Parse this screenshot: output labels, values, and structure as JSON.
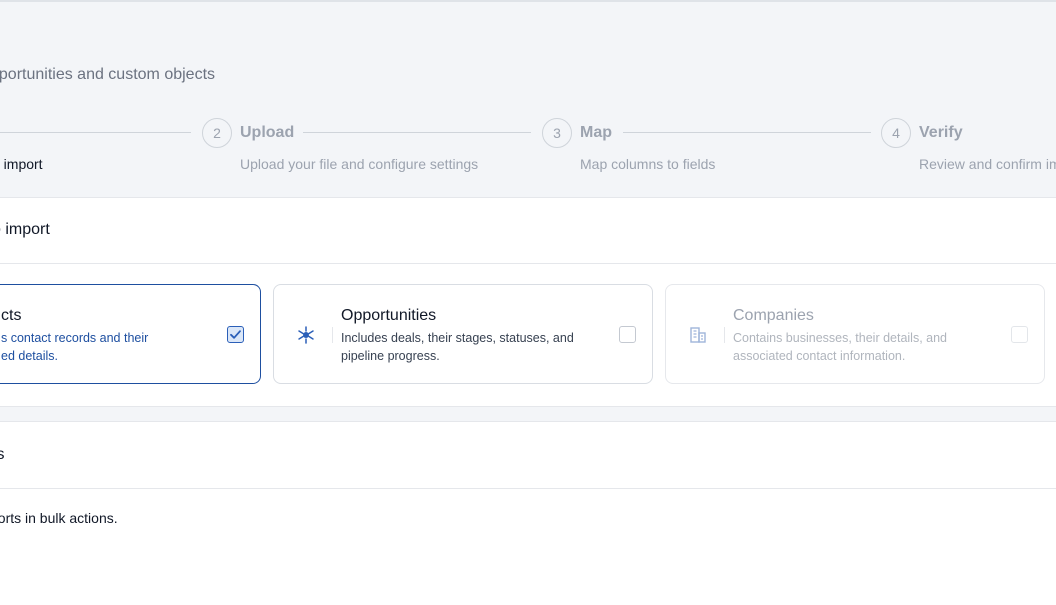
{
  "header": {
    "subtitle": "pportunities and custom objects"
  },
  "steps": [
    {
      "number": "",
      "title": "",
      "description": "o import"
    },
    {
      "number": "2",
      "title": "Upload",
      "description": "Upload your file and configure settings"
    },
    {
      "number": "3",
      "title": "Map",
      "description": "Map columns to fields"
    },
    {
      "number": "4",
      "title": "Verify",
      "description": "Review and confirm im"
    }
  ],
  "select_section": {
    "title": "o import",
    "cards": [
      {
        "title": "cts",
        "description": "s contact records and their ed details.",
        "desc_line1": "s contact records and their",
        "desc_line2": "ed details.",
        "selected": true,
        "icon": "contacts-icon"
      },
      {
        "title": "Opportunities",
        "description": "Includes deals, their stages, statuses, and pipeline progress.",
        "desc_line1": "Includes deals, their stages, statuses, and",
        "desc_line2": "pipeline progress.",
        "selected": false,
        "icon": "opportunities-icon"
      },
      {
        "title": "Companies",
        "description": "Contains businesses, their details, and associated contact information.",
        "desc_line1": "Contains businesses, their details, and",
        "desc_line2": "associated contact information.",
        "selected": false,
        "disabled": true,
        "icon": "building-icon"
      }
    ]
  },
  "options_section": {
    "title": "ts",
    "note": "ports in bulk actions."
  },
  "colors": {
    "accent": "#1e4fa0",
    "muted": "#9ca3af",
    "header_bg": "#f3f5f8"
  }
}
